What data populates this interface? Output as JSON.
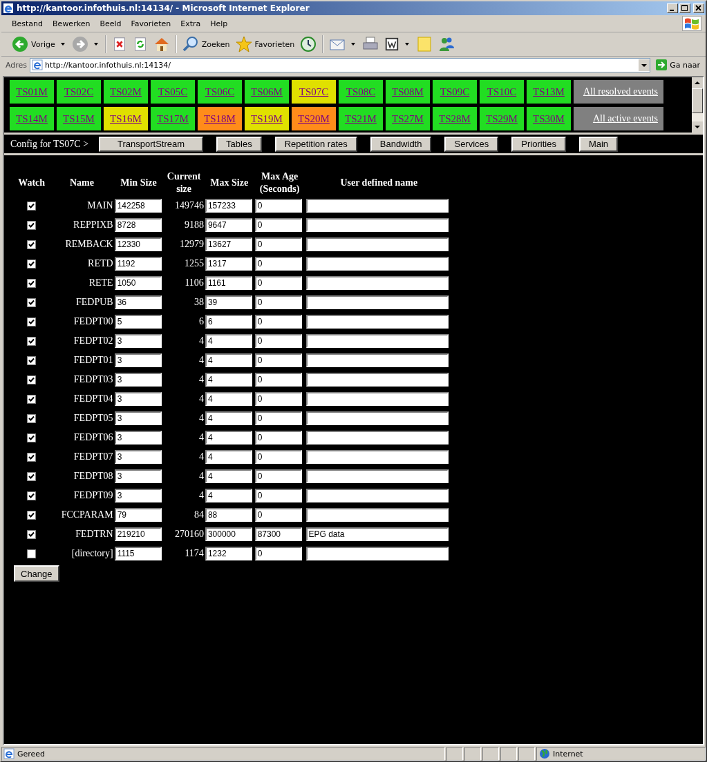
{
  "window": {
    "title": "http://kantoor.infothuis.nl:14134/ - Microsoft Internet Explorer"
  },
  "menu": [
    "Bestand",
    "Bewerken",
    "Beeld",
    "Favorieten",
    "Extra",
    "Help"
  ],
  "toolbar": [
    {
      "kind": "back",
      "label": "Vorige",
      "menu": true
    },
    {
      "kind": "forward",
      "menu": true
    },
    {
      "kind": "stop",
      "menu": false
    },
    {
      "kind": "refresh",
      "menu": false
    },
    {
      "kind": "home",
      "menu": false
    },
    {
      "kind": "search",
      "label": "Zoeken",
      "menu": false
    },
    {
      "kind": "favorites",
      "label": "Favorieten",
      "menu": false
    },
    {
      "kind": "history",
      "menu": false
    },
    {
      "kind": "mail",
      "menu": true
    },
    {
      "kind": "print",
      "menu": false
    },
    {
      "kind": "edit",
      "menu": true
    },
    {
      "kind": "note",
      "menu": false
    },
    {
      "kind": "messenger",
      "menu": false
    }
  ],
  "address": {
    "label": "Adres",
    "value": "http://kantoor.infothuis.nl:14134/",
    "go": "Ga naar"
  },
  "station_rows": [
    {
      "stations": [
        {
          "label": "TS01M",
          "color": "#22dd22"
        },
        {
          "label": "TS02C",
          "color": "#22dd22"
        },
        {
          "label": "TS02M",
          "color": "#22dd22"
        },
        {
          "label": "TS05C",
          "color": "#22dd22"
        },
        {
          "label": "TS06C",
          "color": "#22dd22"
        },
        {
          "label": "TS06M",
          "color": "#22dd22"
        },
        {
          "label": "TS07C",
          "color": "#e0e000"
        },
        {
          "label": "TS08C",
          "color": "#22dd22"
        },
        {
          "label": "TS08M",
          "color": "#22dd22"
        },
        {
          "label": "TS09C",
          "color": "#22dd22"
        },
        {
          "label": "TS10C",
          "color": "#22dd22"
        },
        {
          "label": "TS13M",
          "color": "#22dd22"
        }
      ],
      "summary": "All resolved events"
    },
    {
      "stations": [
        {
          "label": "TS14M",
          "color": "#22dd22"
        },
        {
          "label": "TS15M",
          "color": "#22dd22"
        },
        {
          "label": "TS16M",
          "color": "#e0e000"
        },
        {
          "label": "TS17M",
          "color": "#22dd22"
        },
        {
          "label": "TS18M",
          "color": "#ff8c1a"
        },
        {
          "label": "TS19M",
          "color": "#e0e000"
        },
        {
          "label": "TS20M",
          "color": "#ff8c1a"
        },
        {
          "label": "TS21M",
          "color": "#22dd22"
        },
        {
          "label": "TS27M",
          "color": "#22dd22"
        },
        {
          "label": "TS28M",
          "color": "#22dd22"
        },
        {
          "label": "TS29M",
          "color": "#22dd22"
        },
        {
          "label": "TS30M",
          "color": "#22dd22"
        }
      ],
      "summary": "All active events"
    }
  ],
  "config": {
    "label": "Config for TS07C >",
    "buttons": [
      "TransportStream",
      "Tables",
      "Repetition rates",
      "Bandwidth",
      "Services",
      "Priorities",
      "Main"
    ]
  },
  "table": {
    "columns": [
      "Watch",
      "Name",
      "Min Size",
      "Current size",
      "Max Size",
      "Max Age (Seconds)",
      "User defined name"
    ],
    "rows": [
      {
        "watch": true,
        "name": "MAIN",
        "min": "142258",
        "current": "149746",
        "max": "157233",
        "age": "0"
      },
      {
        "watch": true,
        "name": "REPPIXB",
        "min": "8728",
        "current": "9188",
        "max": "9647",
        "age": "0"
      },
      {
        "watch": true,
        "name": "REMBACK",
        "min": "12330",
        "current": "12979",
        "max": "13627",
        "age": "0"
      },
      {
        "watch": true,
        "name": "RETD",
        "min": "1192",
        "current": "1255",
        "max": "1317",
        "age": "0"
      },
      {
        "watch": true,
        "name": "RETE",
        "min": "1050",
        "current": "1106",
        "max": "1161",
        "age": "0"
      },
      {
        "watch": true,
        "name": "FEDPUB",
        "min": "36",
        "current": "38",
        "max": "39",
        "age": "0"
      },
      {
        "watch": true,
        "name": "FEDPT00",
        "min": "5",
        "current": "6",
        "max": "6",
        "age": "0"
      },
      {
        "watch": true,
        "name": "FEDPT02",
        "min": "3",
        "current": "4",
        "max": "4",
        "age": "0"
      },
      {
        "watch": true,
        "name": "FEDPT01",
        "min": "3",
        "current": "4",
        "max": "4",
        "age": "0"
      },
      {
        "watch": true,
        "name": "FEDPT03",
        "min": "3",
        "current": "4",
        "max": "4",
        "age": "0"
      },
      {
        "watch": true,
        "name": "FEDPT04",
        "min": "3",
        "current": "4",
        "max": "4",
        "age": "0"
      },
      {
        "watch": true,
        "name": "FEDPT05",
        "min": "3",
        "current": "4",
        "max": "4",
        "age": "0"
      },
      {
        "watch": true,
        "name": "FEDPT06",
        "min": "3",
        "current": "4",
        "max": "4",
        "age": "0"
      },
      {
        "watch": true,
        "name": "FEDPT07",
        "min": "3",
        "current": "4",
        "max": "4",
        "age": "0"
      },
      {
        "watch": true,
        "name": "FEDPT08",
        "min": "3",
        "current": "4",
        "max": "4",
        "age": "0"
      },
      {
        "watch": true,
        "name": "FEDPT09",
        "min": "3",
        "current": "4",
        "max": "4",
        "age": "0"
      },
      {
        "watch": true,
        "name": "FCCPARAM",
        "min": "79",
        "current": "84",
        "max": "88",
        "age": "0"
      },
      {
        "watch": true,
        "name": "FEDTRN",
        "min": "219210",
        "current": "270160",
        "max": "300000",
        "age": "87300",
        "user": "EPG data"
      },
      {
        "watch": false,
        "name": "[directory]",
        "min": "1115",
        "current": "1174",
        "max": "1232",
        "age": "0"
      }
    ],
    "button": "Change"
  },
  "status": {
    "text": "Gereed",
    "zone": "Internet"
  }
}
